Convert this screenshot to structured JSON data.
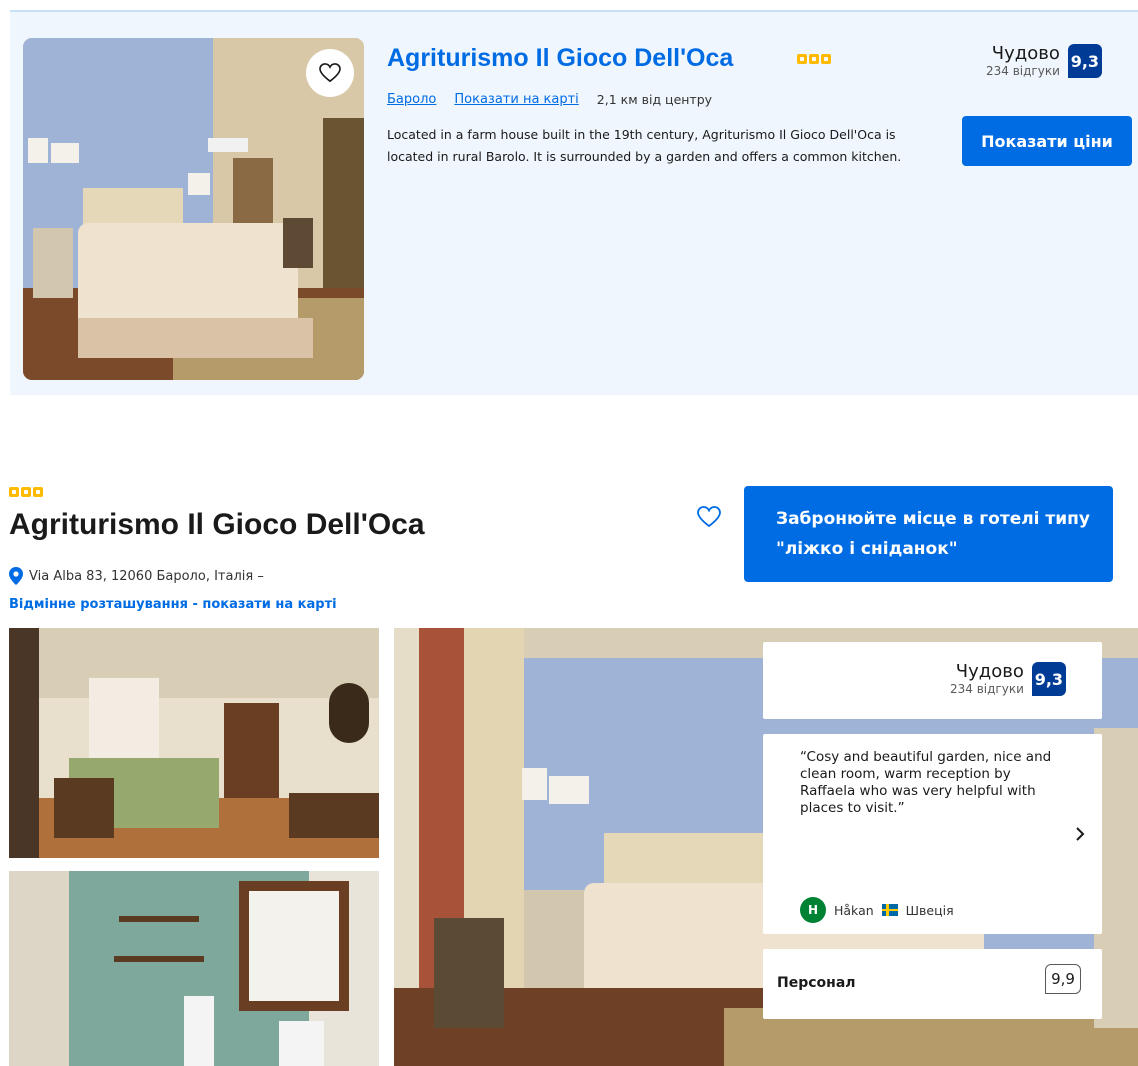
{
  "card": {
    "title": "Agriturismo Il Gioco Dell'Oca",
    "star_count": 3,
    "link_city": "Бароло",
    "link_map": "Показати на карті",
    "distance": "2,1 км від центру",
    "description": "Located in a farm house built in the 19th century, Agriturismo Il Gioco Dell'Oca is located in rural Barolo. It is surrounded by a garden and offers a common kitchen.",
    "rating_word": "Чудово",
    "rating_count": "234 відгуки",
    "score": "9,3",
    "show_prices": "Показати ціни"
  },
  "hotel": {
    "star_count": 3,
    "title": "Agriturismo Il Gioco Dell'Oca",
    "address": "Via Alba 83, 12060 Бароло, Італія –",
    "location_link": "Відмінне розташування - показати на карті",
    "book_button": "Забронюйте місце в готелі типу \"ліжко і сніданок\"",
    "rating_word": "Чудово",
    "rating_count": "234 відгуки",
    "score": "9,3",
    "review_text": "“Cosy and beautiful garden, nice and clean room, warm reception by Raffaela who was very helpful with places to visit.”",
    "reviewer_initial": "H",
    "reviewer_name": "Håkan",
    "reviewer_country": "Швеція",
    "staff_label": "Персонал",
    "staff_score": "9,9"
  },
  "icons": {
    "favorite": "heart-icon",
    "location": "map-pin-icon",
    "next": "chevron-right-icon",
    "flag": "sweden-flag-icon"
  },
  "colors": {
    "brand_blue": "#006ce4",
    "score_navy": "#003b95",
    "star_yellow": "#febb02",
    "card_bg": "#f0f6fd",
    "avatar_green": "#008234"
  }
}
